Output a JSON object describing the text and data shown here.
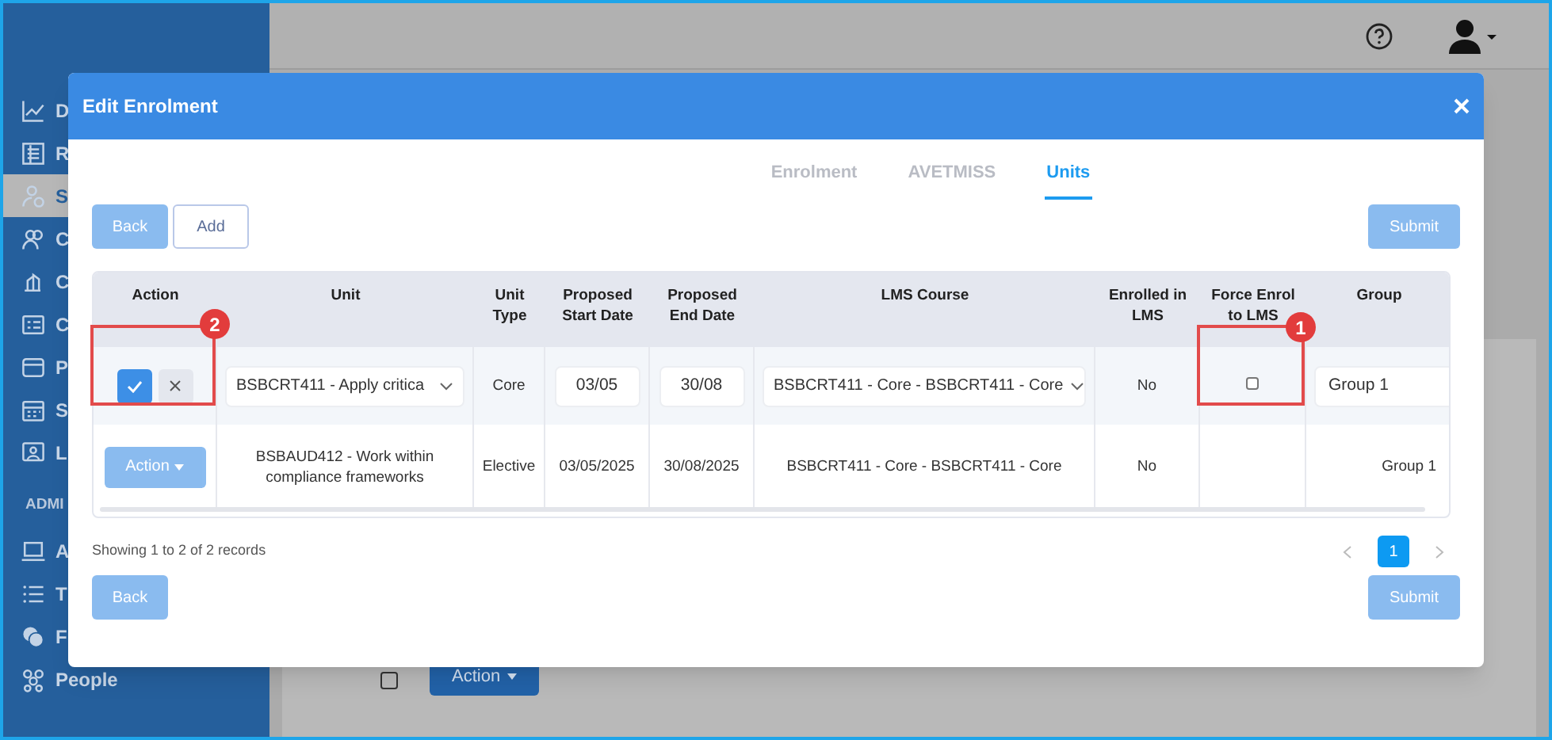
{
  "sidebar": {
    "items": [
      {
        "label": "D",
        "selected": false
      },
      {
        "label": "R",
        "selected": false
      },
      {
        "label": "S",
        "selected": true
      },
      {
        "label": "C",
        "selected": false
      },
      {
        "label": "C",
        "selected": false
      },
      {
        "label": "C",
        "selected": false
      },
      {
        "label": "P",
        "selected": false
      },
      {
        "label": "S",
        "selected": false
      },
      {
        "label": "L",
        "selected": false
      }
    ],
    "admin_heading": "ADMI",
    "admin_items": [
      {
        "label": "A",
        "selected": false
      },
      {
        "label": "T",
        "selected": false
      },
      {
        "label": "F",
        "selected": false
      },
      {
        "label": "People",
        "selected": false
      }
    ]
  },
  "background_row": {
    "checked": false,
    "action": "Action"
  },
  "modal": {
    "title": "Edit Enrolment",
    "tabs": [
      {
        "label": "Enrolment",
        "selected": false
      },
      {
        "label": "AVETMISS",
        "selected": false
      },
      {
        "label": "Units",
        "selected": true
      }
    ],
    "top_buttons": [
      {
        "label": "Back",
        "kind": "primary",
        "disabled": true
      },
      {
        "label": "Add",
        "kind": "outline",
        "disabled": false
      }
    ],
    "top_submit": {
      "label": "Submit",
      "disabled": true
    },
    "table": {
      "columns": [
        "Action",
        "Unit",
        "Unit Type",
        "Proposed Start Date",
        "Proposed End Date",
        "LMS Course",
        "Enrolled in LMS",
        "Force Enrol to LMS",
        "Group"
      ],
      "rows": [
        {
          "kind": "edit",
          "unit": "BSBCRT411 - Apply critica",
          "unit_type": "Core",
          "start": "03/05",
          "end": "30/08",
          "lms_course": "BSBCRT411 - Core - BSBCRT411 - Core",
          "enrolled": "No",
          "force_enrol": false,
          "group": "Group 1",
          "action_callout": "2",
          "force_callout": "1"
        },
        {
          "kind": "view",
          "action": {
            "label": "Action",
            "disabled": true
          },
          "unit": "BSBAUD412 - Work within compliance frameworks",
          "unit_type": "Elective",
          "start": "03/05/2025",
          "end": "30/08/2025",
          "lms_course": "BSBCRT411 - Core - BSBCRT411 - Core",
          "enrolled": "No",
          "group": "Group 1"
        }
      ]
    },
    "summary": "Showing 1 to 2 of 2 records",
    "pages": [
      {
        "label": "1",
        "selected": true
      }
    ],
    "bottom_back": {
      "label": "Back",
      "disabled": true
    },
    "bottom_submit": {
      "label": "Submit",
      "disabled": true
    }
  }
}
